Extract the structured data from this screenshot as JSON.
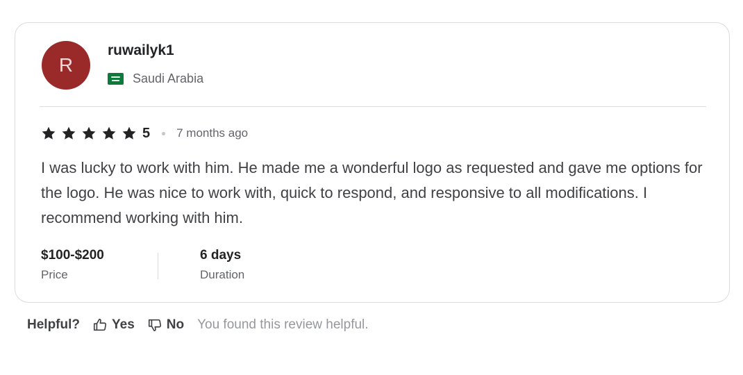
{
  "reviewer": {
    "avatar_initial": "R",
    "avatar_color": "#9a2a2a",
    "username": "ruwailyk1",
    "country": "Saudi Arabia",
    "flag_icon": "saudi-arabia-flag-icon"
  },
  "rating": {
    "stars": 5,
    "value": "5",
    "time_ago": "7 months ago"
  },
  "review": {
    "text": "I was lucky to work with him. He made me a wonderful logo as requested and gave me options for the logo. He was nice to work with, quick to respond, and responsive to all modifications. I recommend working with him."
  },
  "meta": {
    "price_value": "$100-$200",
    "price_label": "Price",
    "duration_value": "6 days",
    "duration_label": "Duration"
  },
  "helpful": {
    "label": "Helpful?",
    "yes_label": "Yes",
    "no_label": "No",
    "note": "You found this review helpful."
  }
}
